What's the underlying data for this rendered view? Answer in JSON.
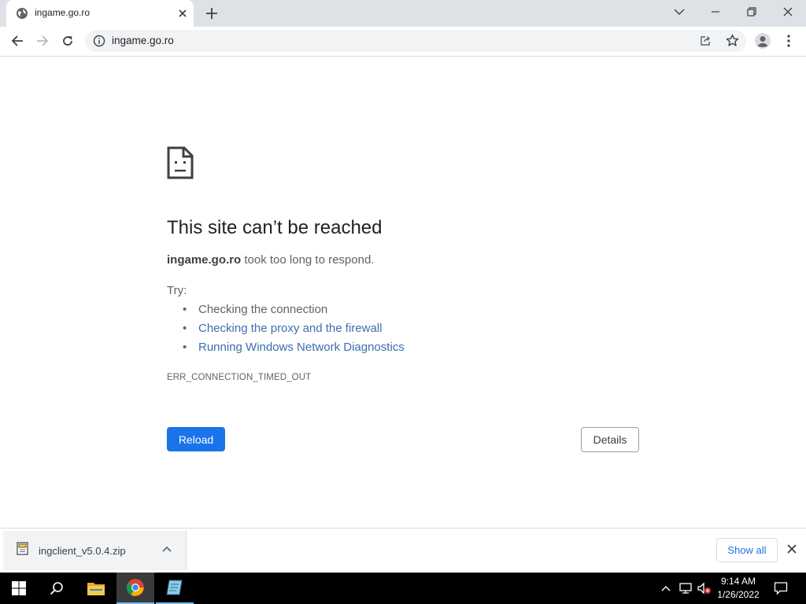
{
  "browser": {
    "tab_title": "ingame.go.ro",
    "url": "ingame.go.ro"
  },
  "error_page": {
    "title": "This site can’t be reached",
    "host": "ingame.go.ro",
    "description_suffix": " took too long to respond.",
    "try_label": "Try:",
    "suggestions": [
      {
        "text": "Checking the connection",
        "link": false
      },
      {
        "text": "Checking the proxy and the firewall",
        "link": true
      },
      {
        "text": "Running Windows Network Diagnostics",
        "link": true
      }
    ],
    "error_code": "ERR_CONNECTION_TIMED_OUT",
    "reload_label": "Reload",
    "details_label": "Details"
  },
  "download_shelf": {
    "file_name": "ingclient_v5.0.4.zip",
    "show_all_label": "Show all"
  },
  "taskbar": {
    "time": "9:14 AM",
    "date": "1/26/2022"
  },
  "colors": {
    "accent": "#1a73e8",
    "link": "#3c6fb1",
    "tabstrip": "#dee1e6"
  }
}
